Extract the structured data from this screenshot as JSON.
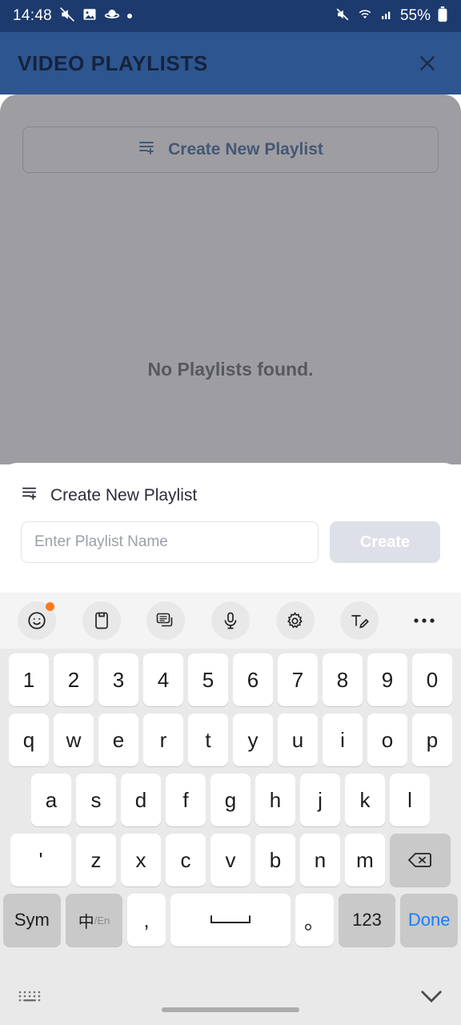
{
  "status_bar": {
    "time": "14:48",
    "battery_percent": "55%",
    "left_icons": [
      "mute-slash-icon",
      "image-icon",
      "saturn-icon",
      "dot-icon"
    ],
    "right_icons": [
      "volume-mute-icon",
      "wifi-icon",
      "signal-icon",
      "battery-icon"
    ]
  },
  "header": {
    "title": "VIDEO PLAYLISTS",
    "close_label": "close-icon",
    "background": "#2d558f"
  },
  "page": {
    "create_button_label": "Create New Playlist",
    "empty_message": "No Playlists found.",
    "accent_color": "#2d558f"
  },
  "sheet": {
    "title": "Create New Playlist",
    "input_placeholder": "Enter Playlist Name",
    "input_value": "",
    "create_button_label": "Create",
    "create_button_disabled_color": "#dde0e8"
  },
  "keyboard": {
    "toolbar": [
      {
        "name": "emoji-icon",
        "badge": true
      },
      {
        "name": "clipboard-icon",
        "badge": false
      },
      {
        "name": "keyboard-switch-icon",
        "badge": false
      },
      {
        "name": "microphone-icon",
        "badge": false
      },
      {
        "name": "gear-icon",
        "badge": false
      },
      {
        "name": "handwriting-icon",
        "badge": false
      },
      {
        "name": "more-icon",
        "badge": false
      }
    ],
    "row_numbers": [
      "1",
      "2",
      "3",
      "4",
      "5",
      "6",
      "7",
      "8",
      "9",
      "0"
    ],
    "row_top": [
      "q",
      "w",
      "e",
      "r",
      "t",
      "y",
      "u",
      "i",
      "o",
      "p"
    ],
    "row_home": [
      "a",
      "s",
      "d",
      "f",
      "g",
      "h",
      "j",
      "k",
      "l"
    ],
    "row_bottom": [
      "z",
      "x",
      "c",
      "v",
      "b",
      "n",
      "m"
    ],
    "apostrophe_key": "'",
    "backspace_key": "backspace-icon",
    "sym_key": "Sym",
    "lang_key_main": "中",
    "lang_key_sub": "/En",
    "comma_key": ",",
    "space_key": "space-icon",
    "period_key": "。",
    "numeric_key": "123",
    "done_key": "Done",
    "footer_left_icon": "keyboard-icon",
    "footer_right_icon": "chevron-down-icon"
  }
}
